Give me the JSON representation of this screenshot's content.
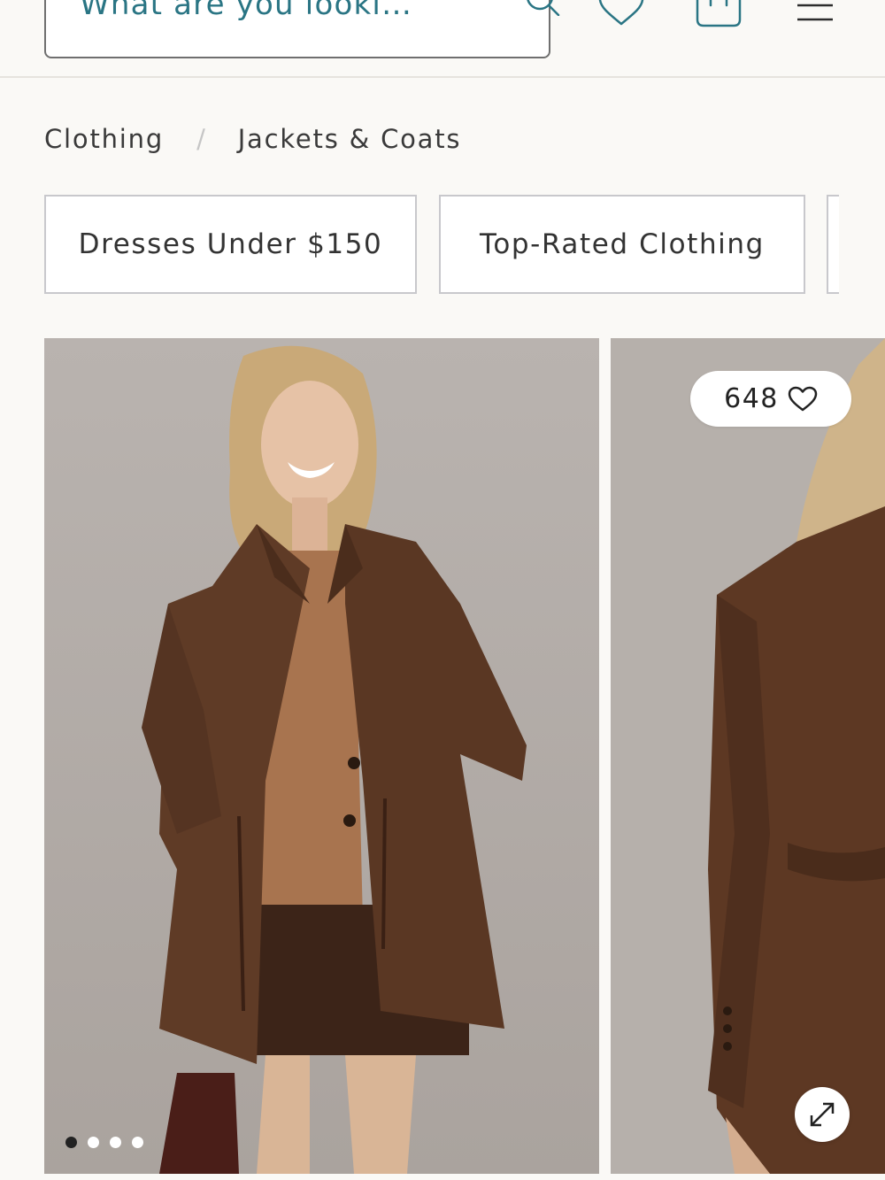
{
  "header": {
    "search_placeholder": "What are you looki…",
    "icons": [
      "search-icon",
      "heart-icon",
      "bag-icon",
      "menu-icon"
    ]
  },
  "breadcrumb": {
    "items": [
      "Clothing",
      "Jackets & Coats"
    ],
    "separator": "/"
  },
  "chips": [
    {
      "label": "Dresses Under $150"
    },
    {
      "label": "Top-Rated Clothing"
    }
  ],
  "product": {
    "likes": "648",
    "carousel_dots": 4,
    "active_dot": 0
  },
  "colors": {
    "accent": "#2a7584",
    "background": "#faf9f6",
    "border": "#c8c8cc"
  }
}
